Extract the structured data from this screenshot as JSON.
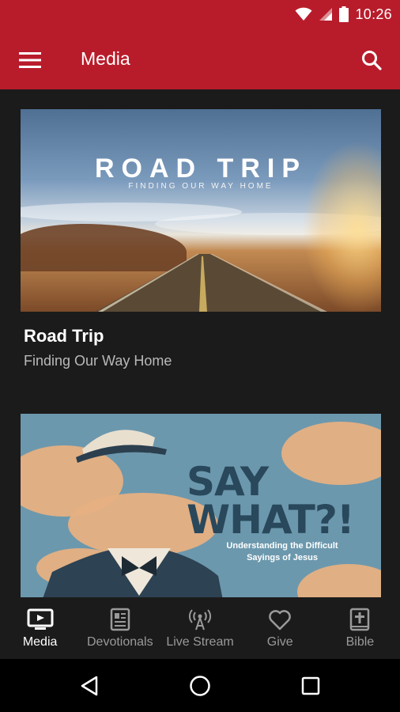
{
  "status_bar": {
    "time": "10:26"
  },
  "app_bar": {
    "title": "Media"
  },
  "cards": [
    {
      "title": "Road Trip",
      "subtitle": "Finding Our Way Home",
      "art_title": "ROAD TRIP",
      "art_subtitle": "FINDING OUR WAY HOME"
    },
    {
      "title": "",
      "subtitle": "",
      "art_title": "SAY WHAT?!",
      "art_subtitle": "Understanding the Difficult Sayings of Jesus"
    }
  ],
  "bottom_nav": {
    "items": [
      {
        "label": "Media",
        "icon": "tv-icon",
        "active": true
      },
      {
        "label": "Devotionals",
        "icon": "newspaper-icon",
        "active": false
      },
      {
        "label": "Live Stream",
        "icon": "broadcast-tower-icon",
        "active": false
      },
      {
        "label": "Give",
        "icon": "heart-icon",
        "active": false
      },
      {
        "label": "Bible",
        "icon": "bible-cross-icon",
        "active": false
      }
    ]
  },
  "colors": {
    "brand_red": "#b81c2b",
    "background": "#1b1b1b",
    "inactive": "#9a9a9a"
  }
}
